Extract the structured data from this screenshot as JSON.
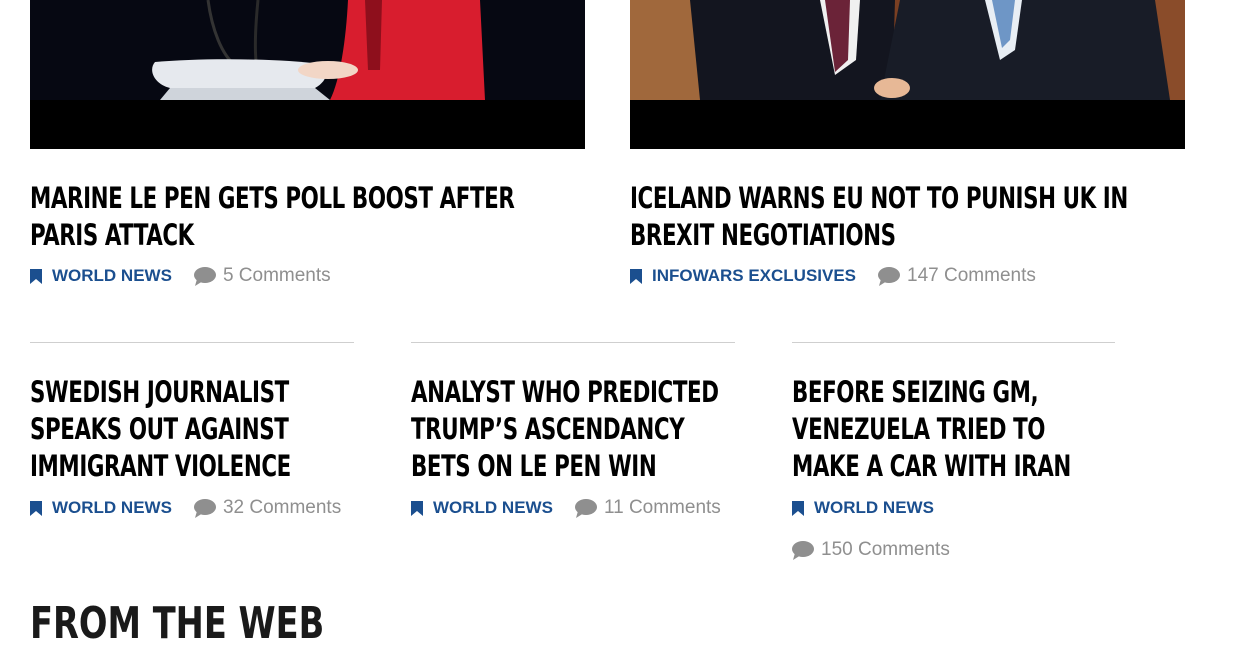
{
  "articles_top": [
    {
      "title": "MARINE LE PEN GETS POLL BOOST AFTER PARIS ATTACK",
      "category": "WORLD NEWS",
      "comments": "5 Comments"
    },
    {
      "title": "ICELAND WARNS EU NOT TO PUNISH UK IN BREXIT NEGOTIATIONS",
      "category": "INFOWARS EXCLUSIVES",
      "comments": "147 Comments"
    }
  ],
  "articles_row": [
    {
      "title": "SWEDISH JOURNALIST SPEAKS OUT AGAINST IMMIGRANT VIOLENCE",
      "category": "WORLD NEWS",
      "comments": "32 Comments"
    },
    {
      "title": "ANALYST WHO PREDICTED TRUMP’S ASCENDANCY BETS ON LE PEN WIN",
      "category": "WORLD NEWS",
      "comments": "11 Comments"
    },
    {
      "title": "BEFORE SEIZING GM, VENEZUELA TRIED TO MAKE A CAR WITH IRAN",
      "category": "WORLD NEWS",
      "comments": "150 Comments"
    }
  ],
  "section_title": "FROM THE WEB",
  "icons": {
    "category": "bookmark-icon",
    "comments": "comment-bubble-icon"
  },
  "colors": {
    "category": "#1b4f8f",
    "comments": "#8f8f8f",
    "headline": "#000000"
  }
}
